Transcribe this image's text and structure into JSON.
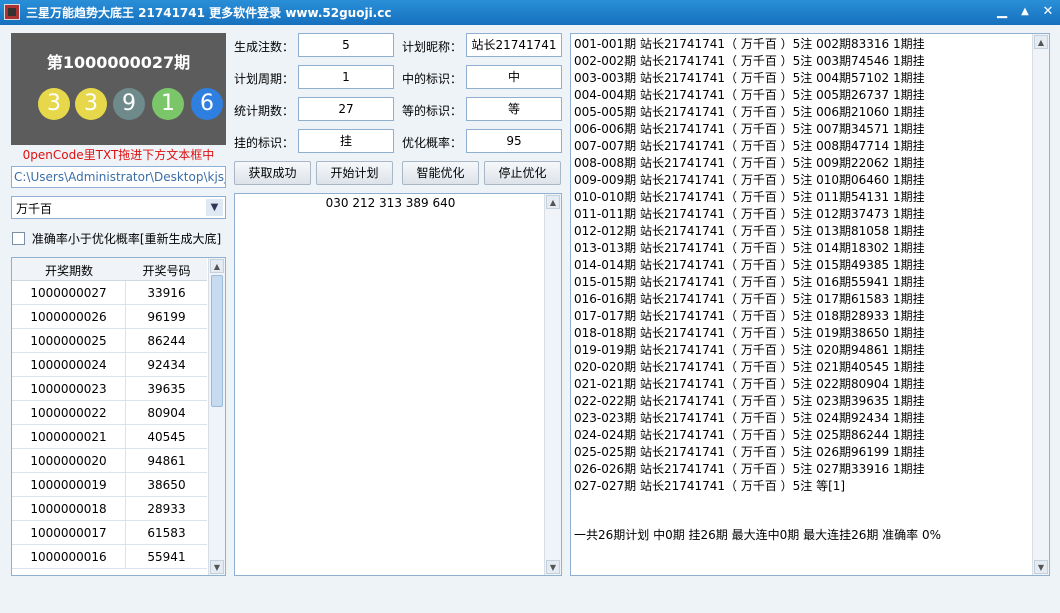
{
  "window": {
    "title": "三星万能趋势大底王 21741741 更多软件登录 www.52guoji.cc",
    "min_glyph": "▁",
    "max_glyph": "▲",
    "close_glyph": "✕"
  },
  "lottery": {
    "period": "第1000000027期",
    "balls": [
      {
        "digit": "3",
        "color": "#e6d84a"
      },
      {
        "digit": "3",
        "color": "#e6d84a"
      },
      {
        "digit": "9",
        "color": "#6f8a8a"
      },
      {
        "digit": "1",
        "color": "#7cc66a"
      },
      {
        "digit": "6",
        "color": "#2f7fe0"
      }
    ]
  },
  "hint": "0penCode里TXT拖进下方文本框中",
  "file_path": "C:\\Users\\Administrator\\Desktop\\kjsj",
  "position_select": {
    "value": "万千百"
  },
  "accuracy_checkbox": {
    "label": "准确率小于优化概率[重新生成大底]",
    "checked": false
  },
  "history_table": {
    "headers": [
      "开奖期数",
      "开奖号码"
    ],
    "rows": [
      [
        "1000000027",
        "33916"
      ],
      [
        "1000000026",
        "96199"
      ],
      [
        "1000000025",
        "86244"
      ],
      [
        "1000000024",
        "92434"
      ],
      [
        "1000000023",
        "39635"
      ],
      [
        "1000000022",
        "80904"
      ],
      [
        "1000000021",
        "40545"
      ],
      [
        "1000000020",
        "94861"
      ],
      [
        "1000000019",
        "38650"
      ],
      [
        "1000000018",
        "28933"
      ],
      [
        "1000000017",
        "61583"
      ],
      [
        "1000000016",
        "55941"
      ]
    ]
  },
  "form": {
    "gen_count": {
      "label": "生成注数：",
      "value": "5"
    },
    "plan_cycle": {
      "label": "计划周期：",
      "value": "1"
    },
    "stat_periods": {
      "label": "统计期数：",
      "value": "27"
    },
    "miss_mark": {
      "label": "挂的标识：",
      "value": "挂"
    },
    "plan_name": {
      "label": "计划昵称：",
      "value": "站长21741741"
    },
    "hit_mark": {
      "label": "中的标识：",
      "value": "中"
    },
    "wait_mark": {
      "label": "等的标识：",
      "value": "等"
    },
    "opt_prob": {
      "label": "优化概率：",
      "value": "95"
    }
  },
  "buttons": {
    "fetch": "获取成功",
    "start": "开始计划",
    "smart": "智能优化",
    "stop": "停止优化"
  },
  "generated_numbers": "030 212 313 389 640",
  "plan_lines": [
    "001-001期 站长21741741（ 万千百 ）5注 002期83316 1期挂",
    "002-002期 站长21741741（ 万千百 ）5注 003期74546 1期挂",
    "003-003期 站长21741741（ 万千百 ）5注 004期57102 1期挂",
    "004-004期 站长21741741（ 万千百 ）5注 005期26737 1期挂",
    "005-005期 站长21741741（ 万千百 ）5注 006期21060 1期挂",
    "006-006期 站长21741741（ 万千百 ）5注 007期34571 1期挂",
    "007-007期 站长21741741（ 万千百 ）5注 008期47714 1期挂",
    "008-008期 站长21741741（ 万千百 ）5注 009期22062 1期挂",
    "009-009期 站长21741741（ 万千百 ）5注 010期06460 1期挂",
    "010-010期 站长21741741（ 万千百 ）5注 011期54131 1期挂",
    "011-011期 站长21741741（ 万千百 ）5注 012期37473 1期挂",
    "012-012期 站长21741741（ 万千百 ）5注 013期81058 1期挂",
    "013-013期 站长21741741（ 万千百 ）5注 014期18302 1期挂",
    "014-014期 站长21741741（ 万千百 ）5注 015期49385 1期挂",
    "015-015期 站长21741741（ 万千百 ）5注 016期55941 1期挂",
    "016-016期 站长21741741（ 万千百 ）5注 017期61583 1期挂",
    "017-017期 站长21741741（ 万千百 ）5注 018期28933 1期挂",
    "018-018期 站长21741741（ 万千百 ）5注 019期38650 1期挂",
    "019-019期 站长21741741（ 万千百 ）5注 020期94861 1期挂",
    "020-020期 站长21741741（ 万千百 ）5注 021期40545 1期挂",
    "021-021期 站长21741741（ 万千百 ）5注 022期80904 1期挂",
    "022-022期 站长21741741（ 万千百 ）5注 023期39635 1期挂",
    "023-023期 站长21741741（ 万千百 ）5注 024期92434 1期挂",
    "024-024期 站长21741741（ 万千百 ）5注 025期86244 1期挂",
    "025-025期 站长21741741（ 万千百 ）5注 026期96199 1期挂",
    "026-026期 站长21741741（ 万千百 ）5注 027期33916 1期挂",
    "027-027期 站长21741741（ 万千百 ）5注 等[1]"
  ],
  "summary": "一共26期计划 中0期 挂26期 最大连中0期 最大连挂26期 准确率 0%",
  "scroll_glyphs": {
    "up": "▲",
    "down": "▼",
    "dropdown": "▼"
  }
}
